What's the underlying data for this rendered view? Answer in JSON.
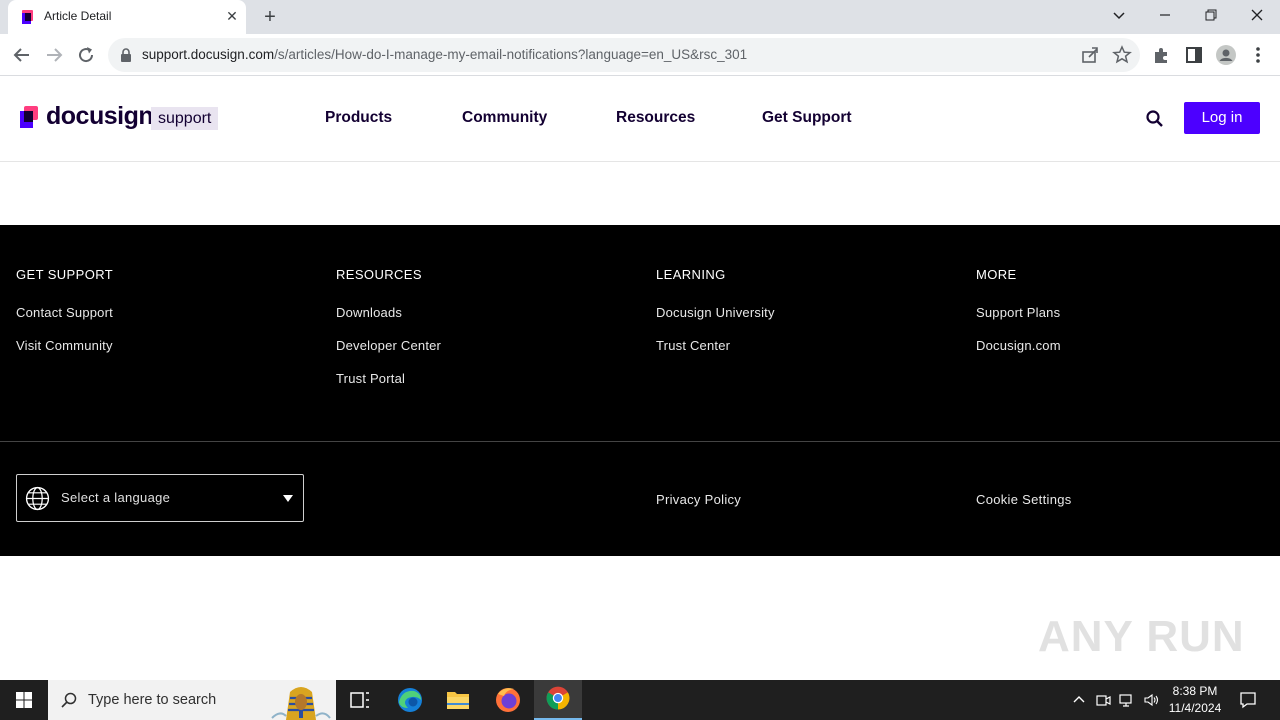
{
  "browser": {
    "tab_title": "Article Detail",
    "url_host": "support.docusign.com",
    "url_path": "/s/articles/How-do-I-manage-my-email-notifications?language=en_US&rsc_301"
  },
  "header": {
    "logo_text": "docusign",
    "logo_badge": "support",
    "nav": [
      "Products",
      "Community",
      "Resources",
      "Get Support"
    ],
    "login_label": "Log in"
  },
  "footer": {
    "columns": [
      {
        "heading": "GET SUPPORT",
        "links": [
          "Contact Support",
          "Visit Community"
        ]
      },
      {
        "heading": "RESOURCES",
        "links": [
          "Downloads",
          "Developer Center",
          "Trust Portal"
        ]
      },
      {
        "heading": "LEARNING",
        "links": [
          "Docusign University",
          "Trust Center"
        ]
      },
      {
        "heading": "MORE",
        "links": [
          "Support Plans",
          "Docusign.com"
        ]
      }
    ],
    "language_placeholder": "Select a language",
    "privacy_label": "Privacy Policy",
    "cookie_label": "Cookie Settings"
  },
  "watermark": "ANY RUN",
  "taskbar": {
    "search_placeholder": "Type here to search",
    "time": "8:38 PM",
    "date": "11/4/2024"
  },
  "colors": {
    "accent": "#4c00ff",
    "brand_text": "#130032",
    "footer_bg": "#000000"
  }
}
